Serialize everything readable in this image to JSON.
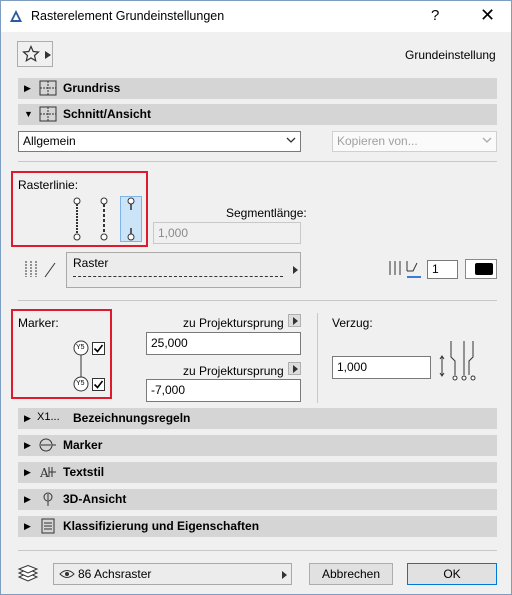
{
  "window": {
    "title": "Rasterelement Grundeinstellungen",
    "help": "?",
    "close": "✕"
  },
  "favorites": {
    "label": "Grundeinstellung"
  },
  "sections": {
    "grundriss": "Grundriss",
    "schnitt": "Schnitt/Ansicht",
    "bezeichnung": "Bezeichnungsregeln",
    "bezeichnung_icon_text": "X1...",
    "marker": "Marker",
    "textstil": "Textstil",
    "ansicht3d": "3D-Ansicht",
    "klassifizierung": "Klassifizierung und Eigenschaften"
  },
  "schnitt_panel": {
    "mode_select": "Allgemein",
    "copy_from_placeholder": "Kopieren von...",
    "rasterlinie_label": "Rasterlinie:",
    "segment_label": "Segmentlänge:",
    "segment_value": "1,000",
    "line_type": "Raster",
    "pen_value": "1",
    "marker_label": "Marker:",
    "marker_top_tag": "Y5",
    "marker_bottom_tag": "Y5",
    "projektursprung_label_1": "zu Projektursprung",
    "projektursprung_value_1": "25,000",
    "projektursprung_label_2": "zu Projektursprung",
    "projektursprung_value_2": "-7,000",
    "verzug_label": "Verzug:",
    "verzug_value": "1,000"
  },
  "footer": {
    "layer": "86 Achsraster",
    "cancel": "Abbrechen",
    "ok": "OK"
  },
  "colors": {
    "highlight": "#e01a2d",
    "selected": "#cce4f7",
    "section_bg": "#d5d5d5"
  }
}
